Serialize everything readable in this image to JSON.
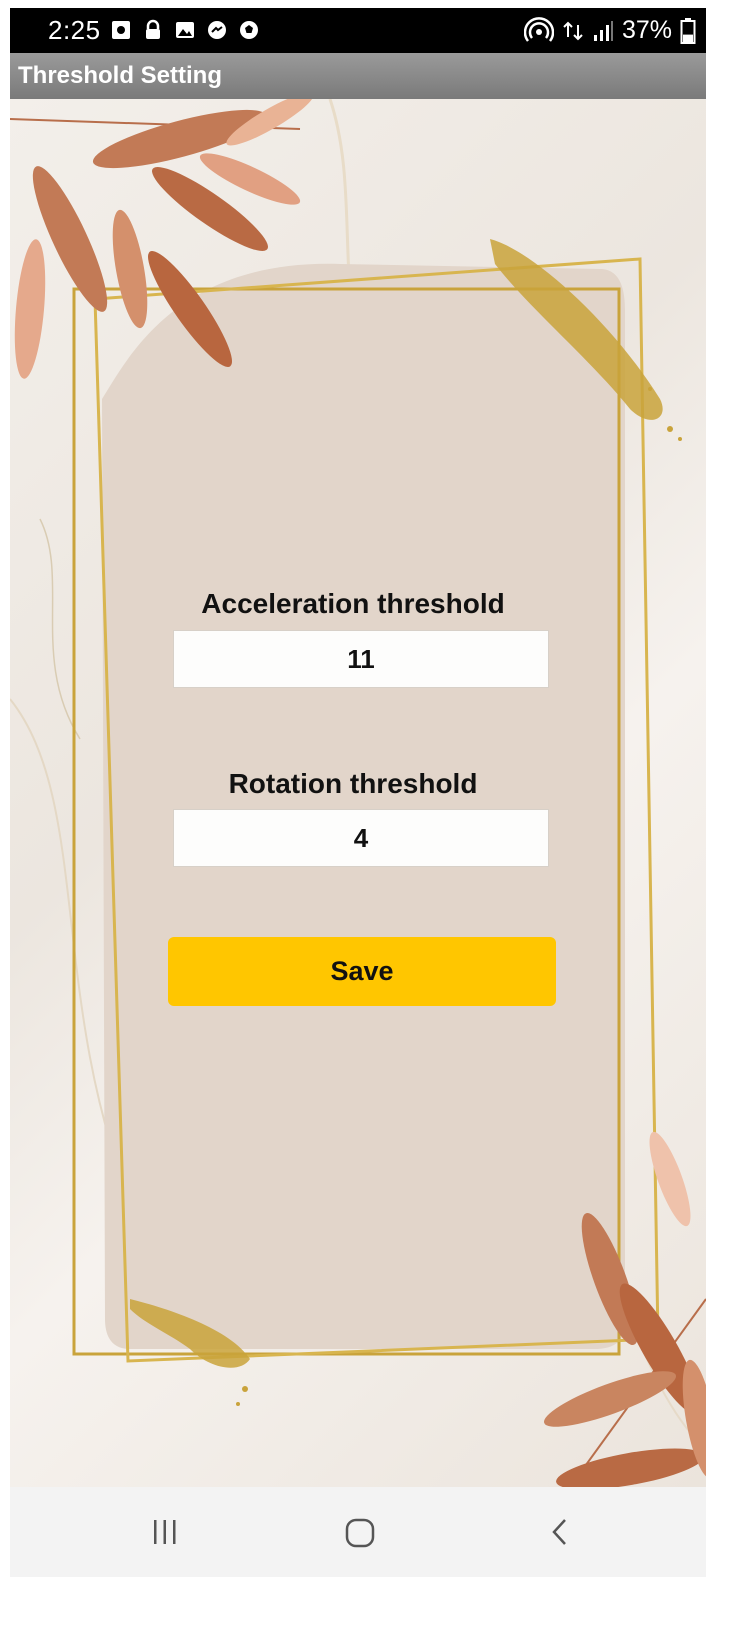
{
  "status_bar": {
    "time": "2:25",
    "battery_percent": "37%",
    "battery_level": 0.37
  },
  "app_bar": {
    "title": "Threshold Setting"
  },
  "form": {
    "acceleration_label": "Acceleration threshold",
    "acceleration_value": "11",
    "rotation_label": "Rotation threshold",
    "rotation_value": "4",
    "save_label": "Save"
  },
  "colors": {
    "accent": "#ffc600",
    "app_bar": "#8a8a8a",
    "card": "#e2d5ca",
    "frame_gold": "#c9a33b",
    "leaf": "#c27a56"
  },
  "nav_bar": {
    "icons": [
      "recent-apps-icon",
      "home-icon",
      "back-icon"
    ]
  }
}
